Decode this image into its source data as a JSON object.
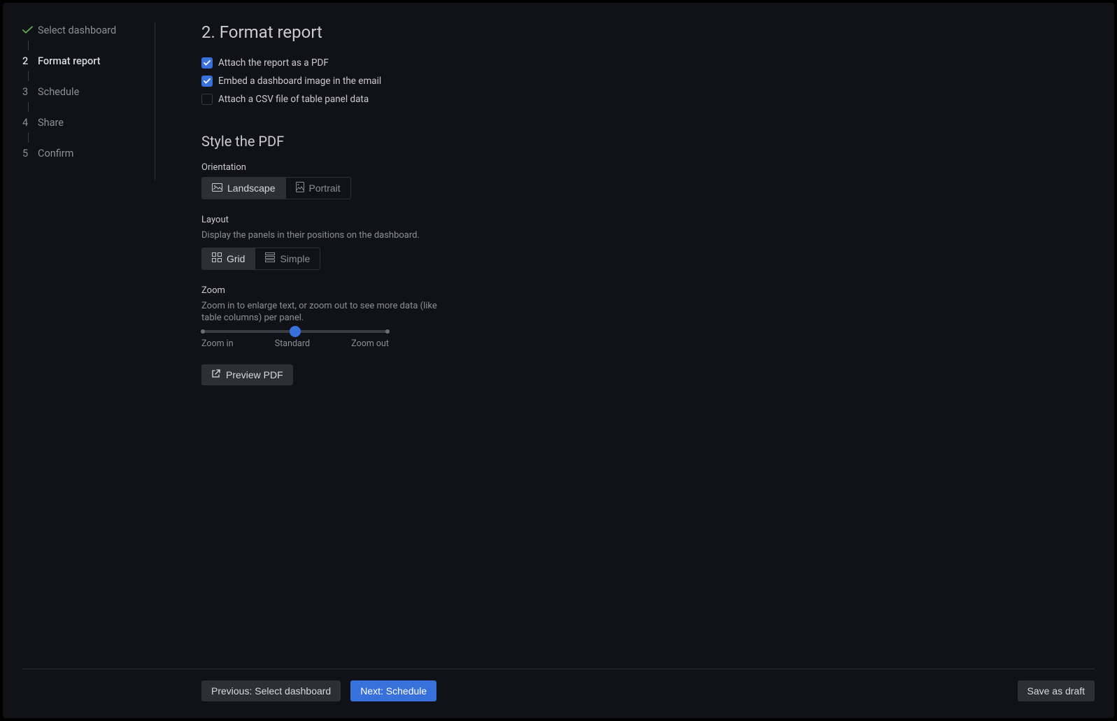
{
  "sidebar": {
    "steps": [
      {
        "num": "",
        "label": "Select dashboard",
        "state": "done"
      },
      {
        "num": "2",
        "label": "Format report",
        "state": "current"
      },
      {
        "num": "3",
        "label": "Schedule",
        "state": "future"
      },
      {
        "num": "4",
        "label": "Share",
        "state": "future"
      },
      {
        "num": "5",
        "label": "Confirm",
        "state": "future"
      }
    ]
  },
  "main": {
    "title": "2. Format report",
    "attach_options": [
      {
        "label": "Attach the report as a PDF",
        "checked": true
      },
      {
        "label": "Embed a dashboard image in the email",
        "checked": true
      },
      {
        "label": "Attach a CSV file of table panel data",
        "checked": false
      }
    ],
    "style_heading": "Style the PDF",
    "orientation": {
      "label": "Orientation",
      "options": [
        {
          "label": "Landscape",
          "active": true
        },
        {
          "label": "Portrait",
          "active": false
        }
      ]
    },
    "layout": {
      "label": "Layout",
      "description": "Display the panels in their positions on the dashboard.",
      "options": [
        {
          "label": "Grid",
          "active": true
        },
        {
          "label": "Simple",
          "active": false
        }
      ]
    },
    "zoom": {
      "label": "Zoom",
      "description": "Zoom in to enlarge text, or zoom out to see more data (like table columns) per panel.",
      "labels": {
        "left": "Zoom in",
        "center": "Standard",
        "right": "Zoom out"
      },
      "value_percent": 50
    },
    "preview_label": "Preview PDF"
  },
  "footer": {
    "previous": "Previous: Select dashboard",
    "next": "Next: Schedule",
    "save": "Save as draft"
  },
  "colors": {
    "background": "#111217",
    "panel": "#2d2f34",
    "text": "#ccccd0",
    "muted": "#8e8f92",
    "accent": "#3871dc"
  }
}
